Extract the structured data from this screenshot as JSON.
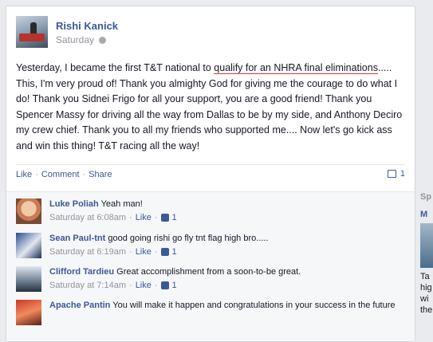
{
  "post": {
    "author": "Rishi Kanick",
    "timestamp": "Saturday",
    "text_parts": [
      "Yesterday, I became the first T&T national to ",
      "qualify for an NHRA final eliminations",
      "..... This, I'm very proud of! Thank you almighty God for giving me the courage to do what I do! Thank you Sidnei Frigo for all your support, you are a good friend! Thank you Spencer Massy for driving all the way from Dallas to be by my side, and Anthony Deciro my crew chief. Thank you to all my friends who supported me.... Now let's go kick ass and win this thing! T&T racing all the way!"
    ],
    "actions": {
      "like": "Like",
      "comment": "Comment",
      "share": "Share",
      "sep": "·"
    },
    "comment_count": "1"
  },
  "comments": [
    {
      "name": "Luke Poliah",
      "text": "Yeah man!",
      "time": "Saturday at 6:08am",
      "like": "Like",
      "likes": "1"
    },
    {
      "name": "Sean Paul-tnt",
      "text": "good going rishi go fly tnt flag high bro.....",
      "time": "Saturday at 6:19am",
      "like": "Like",
      "likes": "1"
    },
    {
      "name": "Clifford Tardieu",
      "text": "Great accomplishment from a soon-to-be great.",
      "time": "Saturday at 7:14am",
      "like": "Like",
      "likes": "1"
    },
    {
      "name": "Apache Pantin",
      "text": "You will make it happen and congratulations in your success in the future",
      "time": "",
      "like": "",
      "likes": ""
    }
  ],
  "sidebar": {
    "head": "Sp",
    "title": "M",
    "lines": [
      "Ta",
      "hig",
      "wi",
      "the"
    ]
  },
  "colors": {
    "link": "#3b5998",
    "muted": "#90949c",
    "background": "#e9ebee"
  }
}
